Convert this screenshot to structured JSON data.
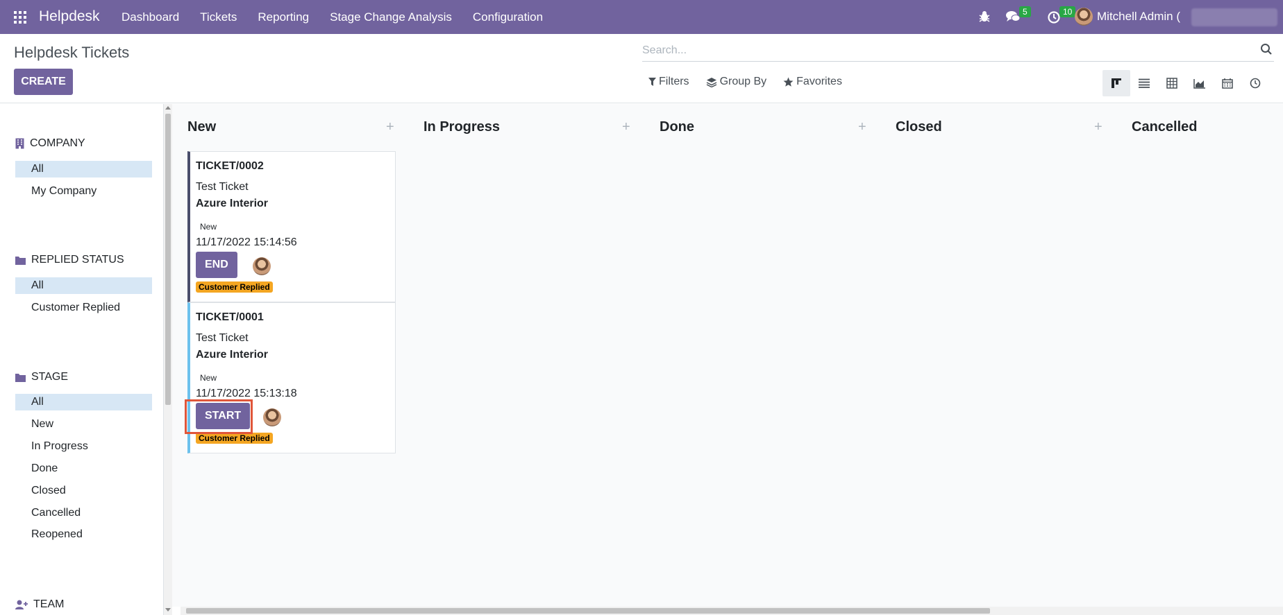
{
  "navbar": {
    "brand": "Helpdesk",
    "menu": [
      "Dashboard",
      "Tickets",
      "Reporting",
      "Stage Change Analysis",
      "Configuration"
    ],
    "chat_count": "5",
    "activity_count": "10",
    "user_name": "Mitchell Admin ("
  },
  "control_panel": {
    "title": "Helpdesk Tickets",
    "create_label": "CREATE",
    "search_placeholder": "Search...",
    "filters_label": "Filters",
    "group_by_label": "Group By",
    "favorites_label": "Favorites"
  },
  "sidebar": {
    "company": {
      "title": "COMPANY",
      "items": [
        "All",
        "My Company"
      ]
    },
    "replied": {
      "title": "REPLIED STATUS",
      "items": [
        "All",
        "Customer Replied"
      ]
    },
    "stage": {
      "title": "STAGE",
      "items": [
        "All",
        "New",
        "In Progress",
        "Done",
        "Closed",
        "Cancelled",
        "Reopened"
      ]
    },
    "team": {
      "title": "TEAM"
    }
  },
  "columns": [
    "New",
    "In Progress",
    "Done",
    "Closed",
    "Cancelled"
  ],
  "cards": [
    {
      "id": "TICKET/0002",
      "name": "Test Ticket",
      "partner": "Azure Interior",
      "stage": "New",
      "date": "11/17/2022 15:14:56",
      "button": "END",
      "tag": "Customer Replied"
    },
    {
      "id": "TICKET/0001",
      "name": "Test Ticket",
      "partner": "Azure Interior",
      "stage": "New",
      "date": "11/17/2022 15:13:18",
      "button": "START",
      "tag": "Customer Replied"
    }
  ],
  "colors": {
    "brand": "#71639e",
    "tag": "#f4a622",
    "badge": "#28a745",
    "highlight": "#e0563a"
  }
}
